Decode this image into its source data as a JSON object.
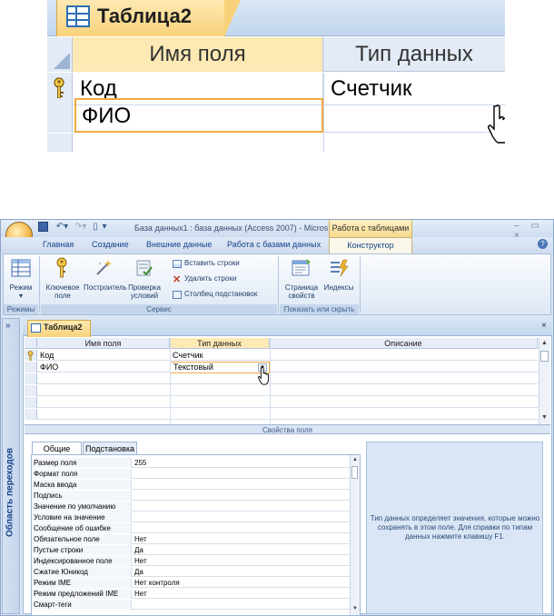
{
  "zoom": {
    "tab_title": "Таблица2",
    "col_field_name": "Имя поля",
    "col_data_type": "Тип данных",
    "rows": [
      {
        "field": "Код",
        "type": "Счетчик"
      },
      {
        "field": "ФИО",
        "type": ""
      }
    ]
  },
  "window": {
    "title": "База данных1 : база данных (Access 2007) - Micros...",
    "context_group": "Работа с таблицами",
    "controls": "– ▭ ×",
    "tabs": [
      "Главная",
      "Создание",
      "Внешние данные",
      "Работа с базами данных"
    ],
    "active_tab": "Конструктор"
  },
  "ribbon": {
    "mode_label": "Режим",
    "mode_arrow": "▾",
    "key_label": "Ключевое поле",
    "builder_label": "Построитель",
    "check_label": "Проверка условий",
    "insert_rows": "Вставить строки",
    "delete_rows": "Удалить строки",
    "lookup_column": "Столбец подстановок",
    "property_sheet": "Страница свойств",
    "indexes": "Индексы",
    "group_modes": "Режимы",
    "group_service": "Сервис",
    "group_show_hide": "Показать или скрыть"
  },
  "nav": {
    "chevron": "»",
    "label": "Область переходов"
  },
  "doc": {
    "tab_title": "Таблица2",
    "close": "×",
    "columns": [
      "Имя поля",
      "Тип данных",
      "Описание"
    ],
    "rows": [
      {
        "field": "Код",
        "type": "Счетчик",
        "desc": ""
      },
      {
        "field": "ФИО",
        "type": "Текстовый",
        "desc": ""
      }
    ],
    "props_bar": "Свойства поля"
  },
  "props": {
    "tab_general": "Общие",
    "tab_lookup": "Подстановка",
    "rows": [
      {
        "label": "Размер поля",
        "value": "255"
      },
      {
        "label": "Формат поля",
        "value": ""
      },
      {
        "label": "Маска ввода",
        "value": ""
      },
      {
        "label": "Подпись",
        "value": ""
      },
      {
        "label": "Значение по умолчанию",
        "value": ""
      },
      {
        "label": "Условие на значение",
        "value": ""
      },
      {
        "label": "Сообщение об ошибке",
        "value": ""
      },
      {
        "label": "Обязательное поле",
        "value": "Нет"
      },
      {
        "label": "Пустые строки",
        "value": "Да"
      },
      {
        "label": "Индексированное поле",
        "value": "Нет"
      },
      {
        "label": "Сжатие Юникод",
        "value": "Да"
      },
      {
        "label": "Режим IME",
        "value": "Нет контроля"
      },
      {
        "label": "Режим предложений IME",
        "value": "Нет"
      },
      {
        "label": "Смарт-теги",
        "value": ""
      }
    ],
    "hint": "Тип данных определяет значения, которые можно сохранять в этом поле. Для справки по типам данных нажмите клавишу F1."
  },
  "colors": {
    "accent_orange": "#f2a940",
    "tab_gold": "#f8d27a",
    "ribbon_blue": "#15428b"
  }
}
